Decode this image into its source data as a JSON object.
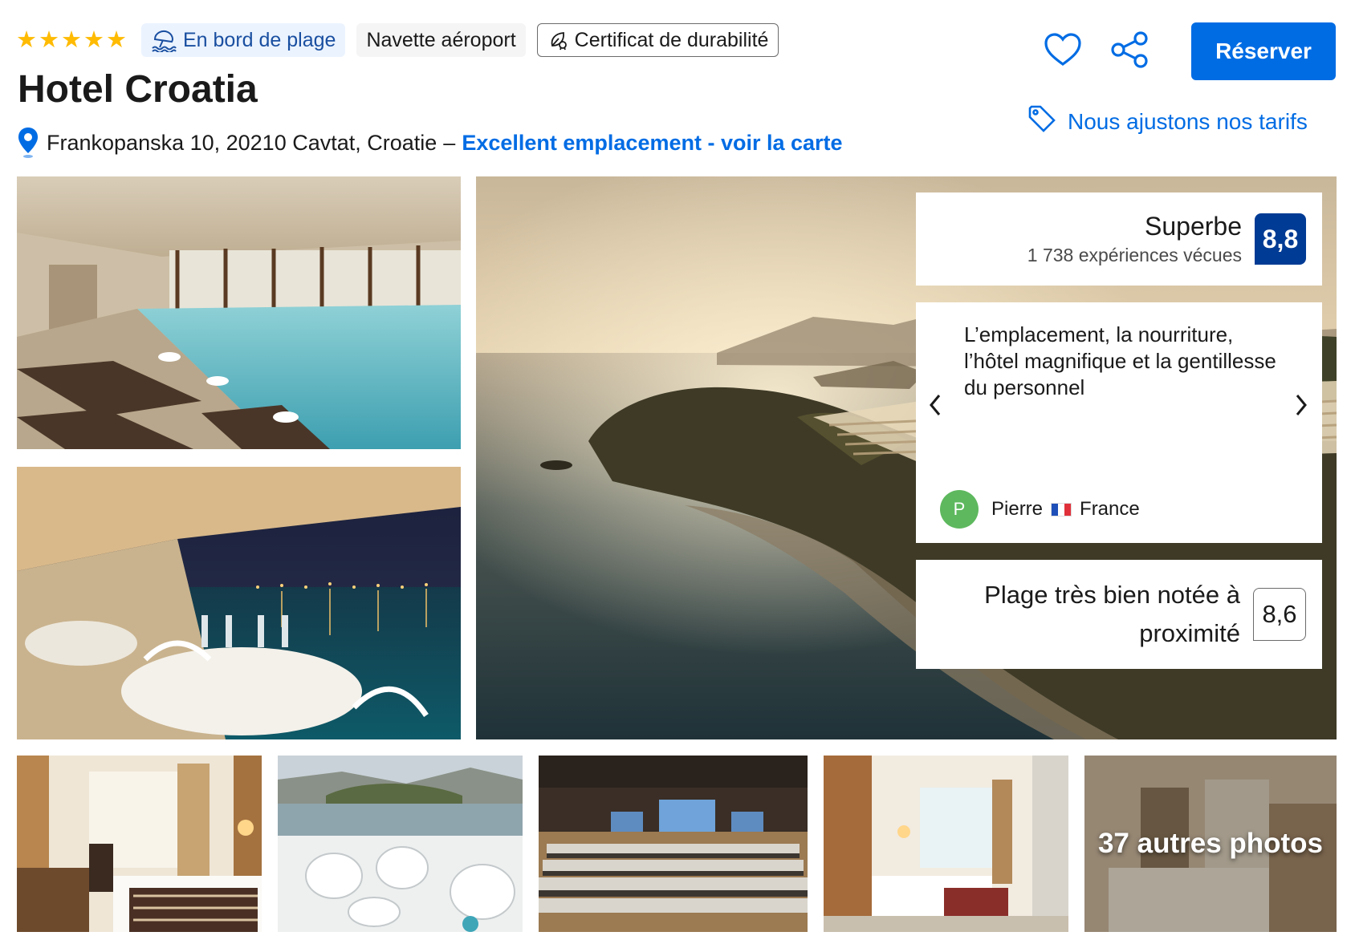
{
  "header": {
    "stars": 5,
    "badges": {
      "beach": "En bord de plage",
      "shuttle": "Navette aéroport",
      "sustainability": "Certificat de durabilité"
    },
    "title": "Hotel Croatia",
    "address": "Frankopanska 10, 20210 Cavtat, Croatie",
    "address_dash": "–",
    "map_link": "Excellent emplacement - voir la carte",
    "reserve_label": "Réserver",
    "price_match": "Nous ajustons nos tarifs"
  },
  "review": {
    "score_word": "Superbe",
    "score_count": "1 738 expériences vécues",
    "score": "8,8",
    "quote": "L’emplacement, la nourriture, l’hôtel magnifique et la gentillesse du personnel",
    "reviewer_initial": "P",
    "reviewer_name": "Pierre",
    "reviewer_country": "France",
    "beach_label": "Plage très bien notée à proximité",
    "beach_score": "8,6"
  },
  "gallery": {
    "more_photos": "37 autres photos"
  },
  "colors": {
    "brand_blue": "#006ce4",
    "score_dark_blue": "#003b95",
    "star_yellow": "#febb02",
    "avatar_green": "#5eb85e"
  },
  "icons": [
    "star-icon",
    "beach-umbrella-icon",
    "sustainability-certificate-icon",
    "location-pin-icon",
    "heart-icon",
    "share-icon",
    "price-tag-icon",
    "chevron-left-icon",
    "chevron-right-icon",
    "france-flag-icon"
  ]
}
